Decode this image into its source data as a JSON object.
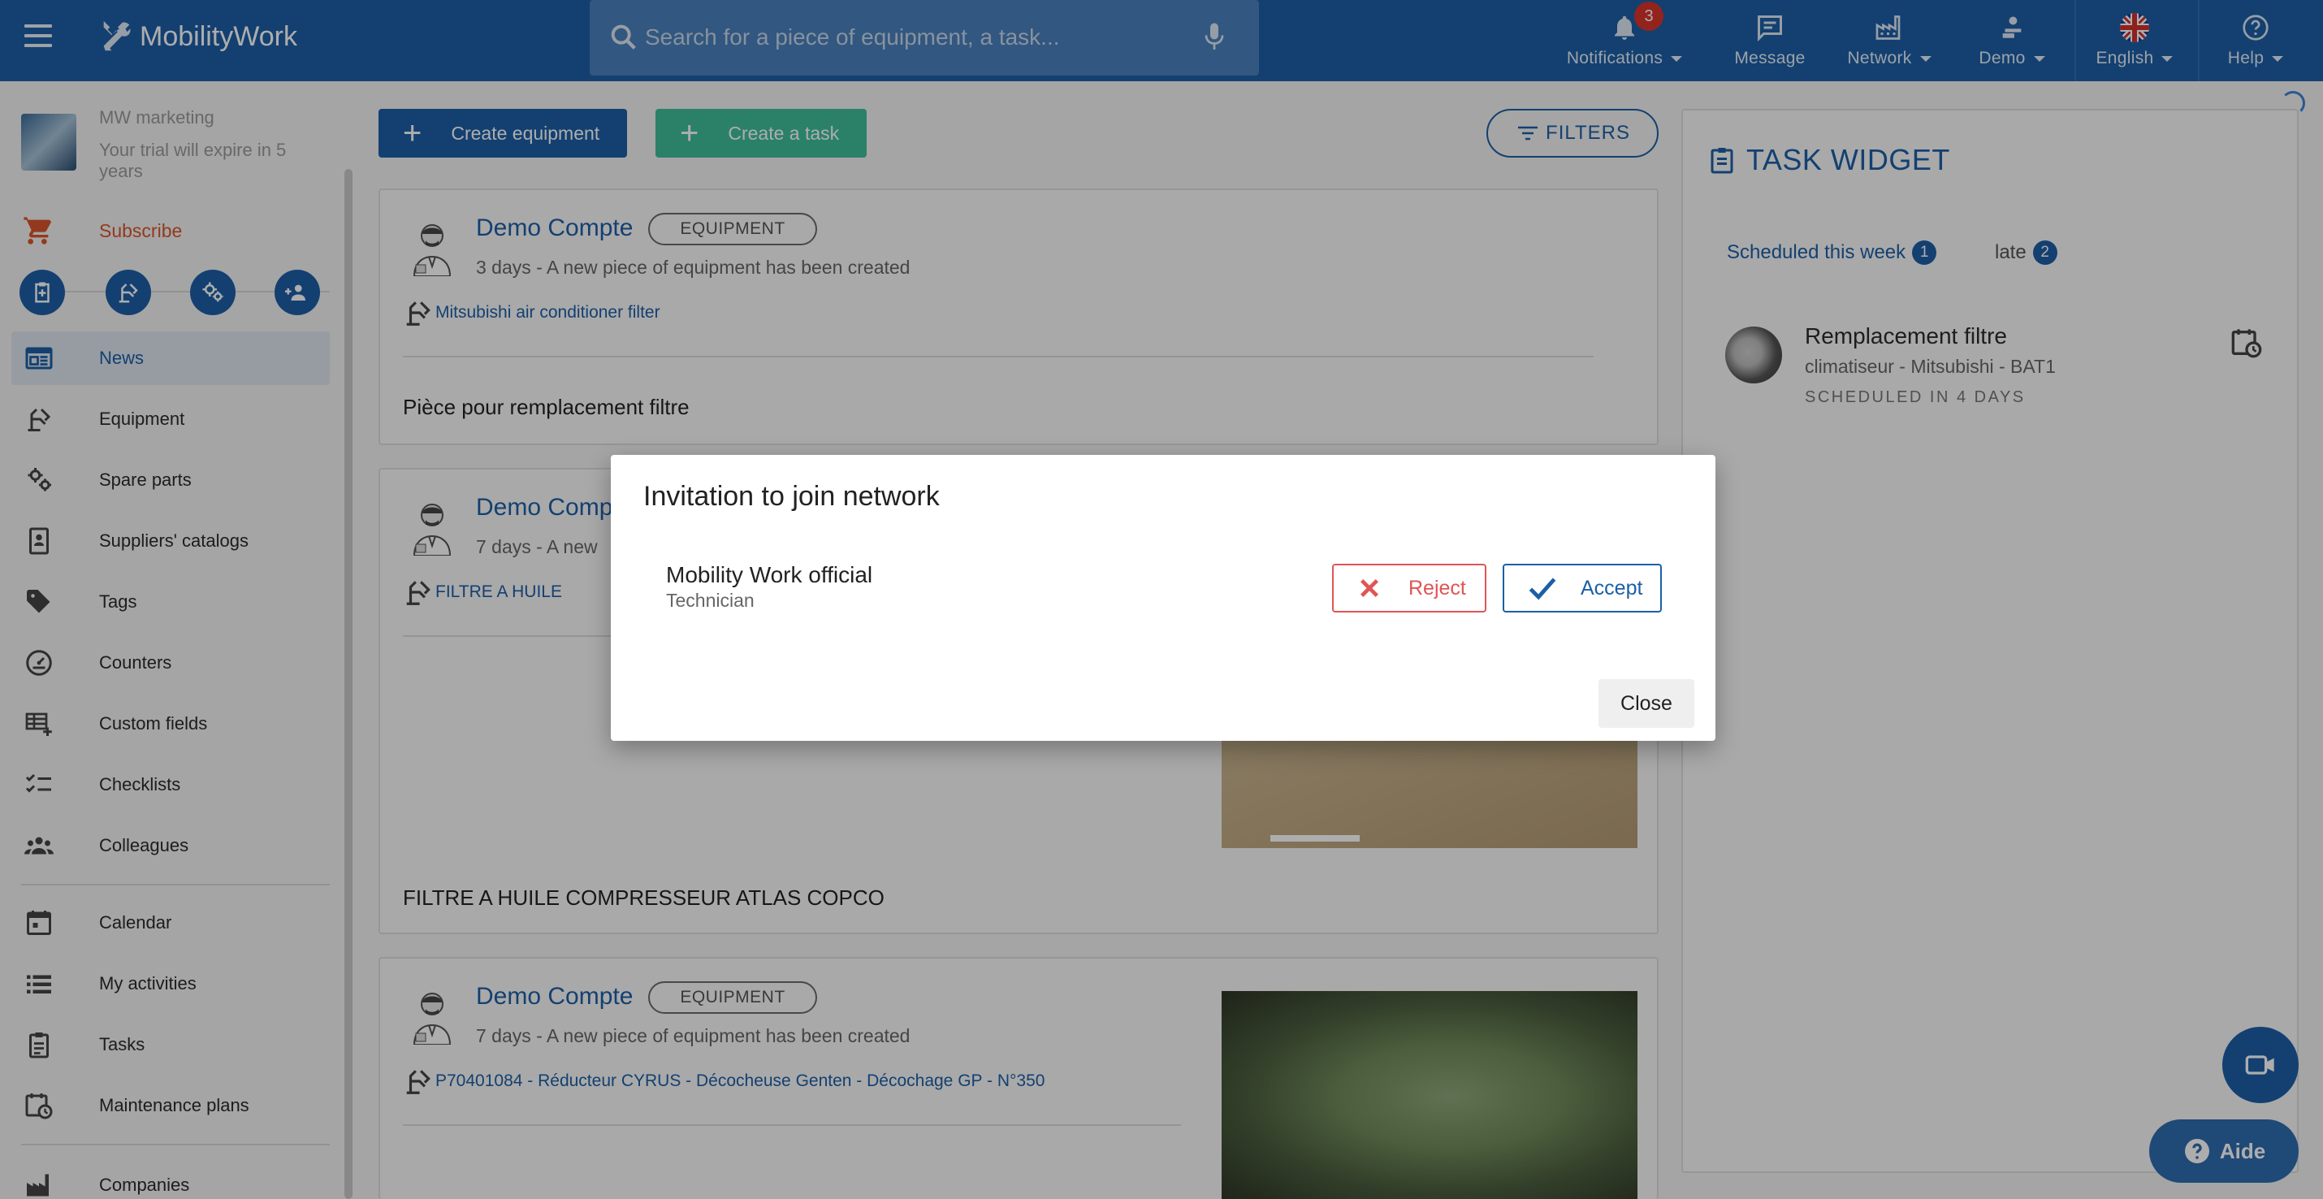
{
  "header": {
    "app_name": "MobilityWork",
    "search_placeholder": "Search for a piece of equipment, a task...",
    "nav": {
      "notifications": {
        "label": "Notifications",
        "count": "3"
      },
      "message": {
        "label": "Message"
      },
      "network": {
        "label": "Network"
      },
      "demo": {
        "label": "Demo"
      },
      "language": {
        "label": "English"
      },
      "help": {
        "label": "Help"
      }
    }
  },
  "sidebar": {
    "profile_name": "MW marketing",
    "trial_text": "Your trial will expire in 5 years",
    "subscribe_label": "Subscribe",
    "menu": [
      {
        "label": "News",
        "icon": "news-icon"
      },
      {
        "label": "Equipment",
        "icon": "equipment-icon"
      },
      {
        "label": "Spare parts",
        "icon": "gears-icon"
      },
      {
        "label": "Suppliers' catalogs",
        "icon": "catalog-icon"
      },
      {
        "label": "Tags",
        "icon": "tag-icon"
      },
      {
        "label": "Counters",
        "icon": "gauge-icon"
      },
      {
        "label": "Custom fields",
        "icon": "table-plus-icon"
      },
      {
        "label": "Checklists",
        "icon": "checklist-icon"
      },
      {
        "label": "Colleagues",
        "icon": "people-icon"
      },
      {
        "label": "Calendar",
        "icon": "calendar-icon"
      },
      {
        "label": "My activities",
        "icon": "list-icon"
      },
      {
        "label": "Tasks",
        "icon": "clipboard-icon"
      },
      {
        "label": "Maintenance plans",
        "icon": "calendar-clock-icon"
      },
      {
        "label": "Companies",
        "icon": "factory-icon"
      }
    ]
  },
  "toolbar": {
    "create_equipment": "Create equipment",
    "create_task": "Create a task",
    "filters": "FILTERS"
  },
  "feed": [
    {
      "author": "Demo Compte",
      "chip": "EQUIPMENT",
      "meta": "3 days - A new piece of equipment has been created",
      "link": "Mitsubishi air conditioner filter",
      "description": "Pièce pour remplacement filtre"
    },
    {
      "author": "Demo Compte",
      "meta": "7 days - A new",
      "link": "FILTRE A HUILE",
      "description": "FILTRE A HUILE COMPRESSEUR ATLAS COPCO"
    },
    {
      "author": "Demo Compte",
      "chip": "EQUIPMENT",
      "meta": "7 days - A new piece of equipment has been created",
      "link": "P70401084 - Réducteur CYRUS - Décocheuse Genten - Décochage GP - N°350"
    }
  ],
  "task_widget": {
    "title": "TASK WIDGET",
    "tab_week": "Scheduled this week",
    "tab_week_count": "1",
    "tab_late": "late",
    "tab_late_count": "2",
    "task": {
      "title": "Remplacement filtre",
      "subtitle": "climatiseur - Mitsubishi - BAT1",
      "schedule": "SCHEDULED IN 4 DAYS"
    }
  },
  "modal": {
    "title": "Invitation to join network",
    "invite_name": "Mobility Work official",
    "invite_role": "Technician",
    "reject_label": "Reject",
    "accept_label": "Accept",
    "close_label": "Close"
  },
  "floating": {
    "aide_label": "Aide"
  },
  "colors": {
    "primary": "#1c5fa7",
    "success": "#3fbf9a",
    "danger": "#e05555",
    "subscribe": "#d9542b"
  }
}
